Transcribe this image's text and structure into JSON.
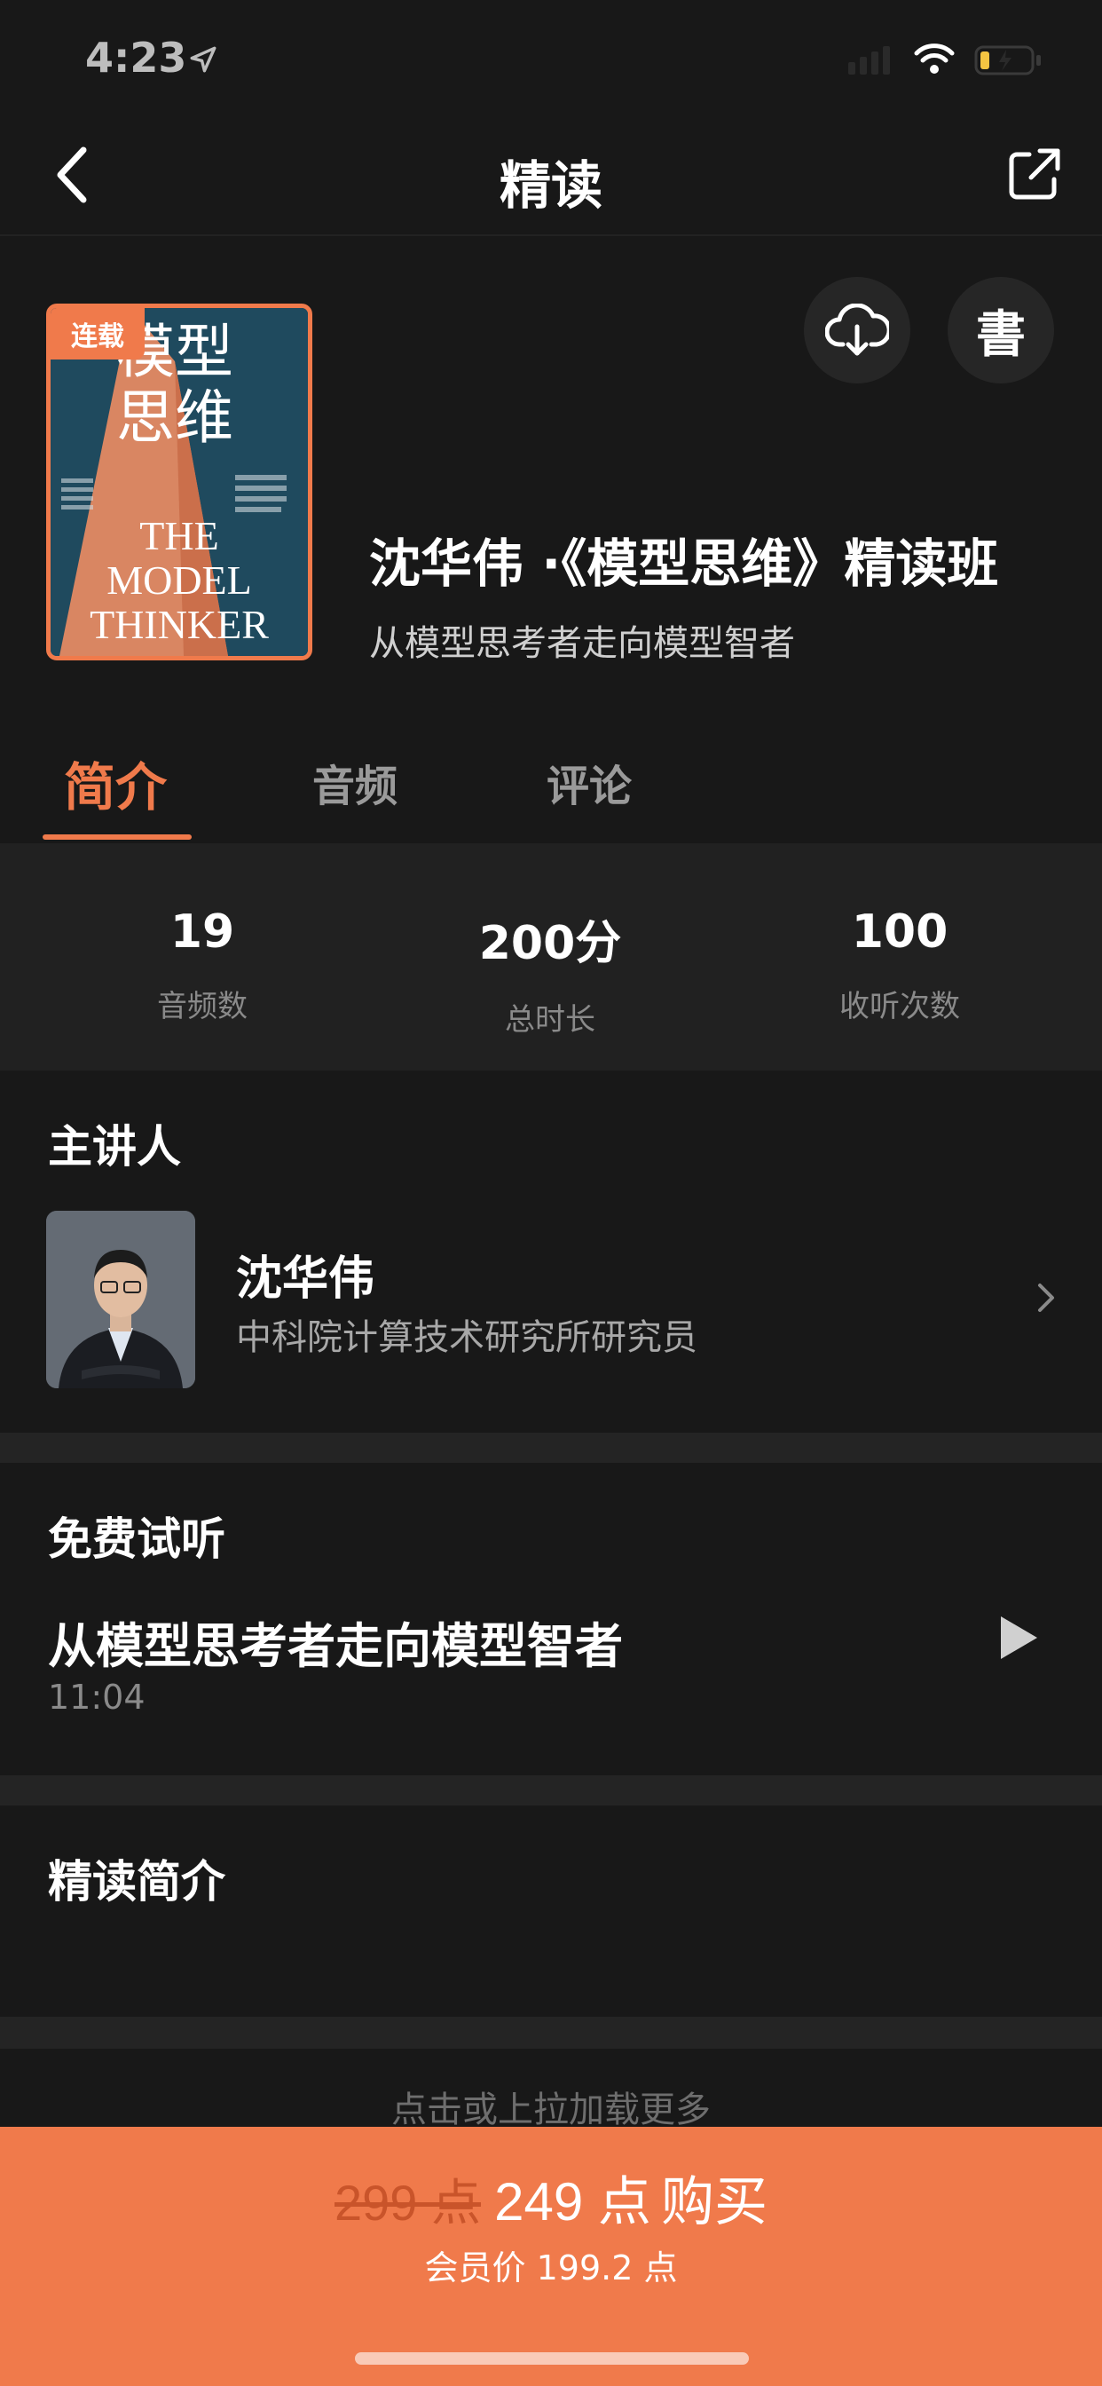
{
  "status_bar": {
    "time": "4:23"
  },
  "nav": {
    "title": "精读",
    "back_icon": "chevron-left-icon",
    "share_icon": "external-share-icon"
  },
  "header": {
    "badge": "连载",
    "cover": {
      "title_cn_line1": "模型",
      "title_cn_line2": "思维",
      "title_en_line1": "THE",
      "title_en_line2": "MODEL",
      "title_en_line3": "THINKER"
    },
    "download_icon": "cloud-download-icon",
    "book_button_label": "書",
    "title": "沈华伟 ·《模型思维》精读班",
    "subtitle": "从模型思考者走向模型智者"
  },
  "tabs": [
    {
      "label": "简介",
      "active": true
    },
    {
      "label": "音频",
      "active": false
    },
    {
      "label": "评论",
      "active": false
    }
  ],
  "stats": [
    {
      "value": "19",
      "label": "音频数"
    },
    {
      "value": "200分",
      "label": "总时长"
    },
    {
      "value": "100",
      "label": "收听次数"
    }
  ],
  "lecturer": {
    "section_title": "主讲人",
    "name": "沈华伟",
    "description": "中科院计算技术研究所研究员"
  },
  "trial": {
    "section_title": "免费试听",
    "episode_title": "从模型思考者走向模型智者",
    "duration": "11:04"
  },
  "intro": {
    "section_title": "精读简介"
  },
  "load_more": "点击或上拉加载更多",
  "purchase": {
    "original_price": "299 点",
    "current_price": "249 点",
    "buy_label": "购买",
    "member_price": "会员价 199.2 点"
  },
  "colors": {
    "accent": "#f07a4b",
    "background": "#181818",
    "panel": "#212121"
  }
}
